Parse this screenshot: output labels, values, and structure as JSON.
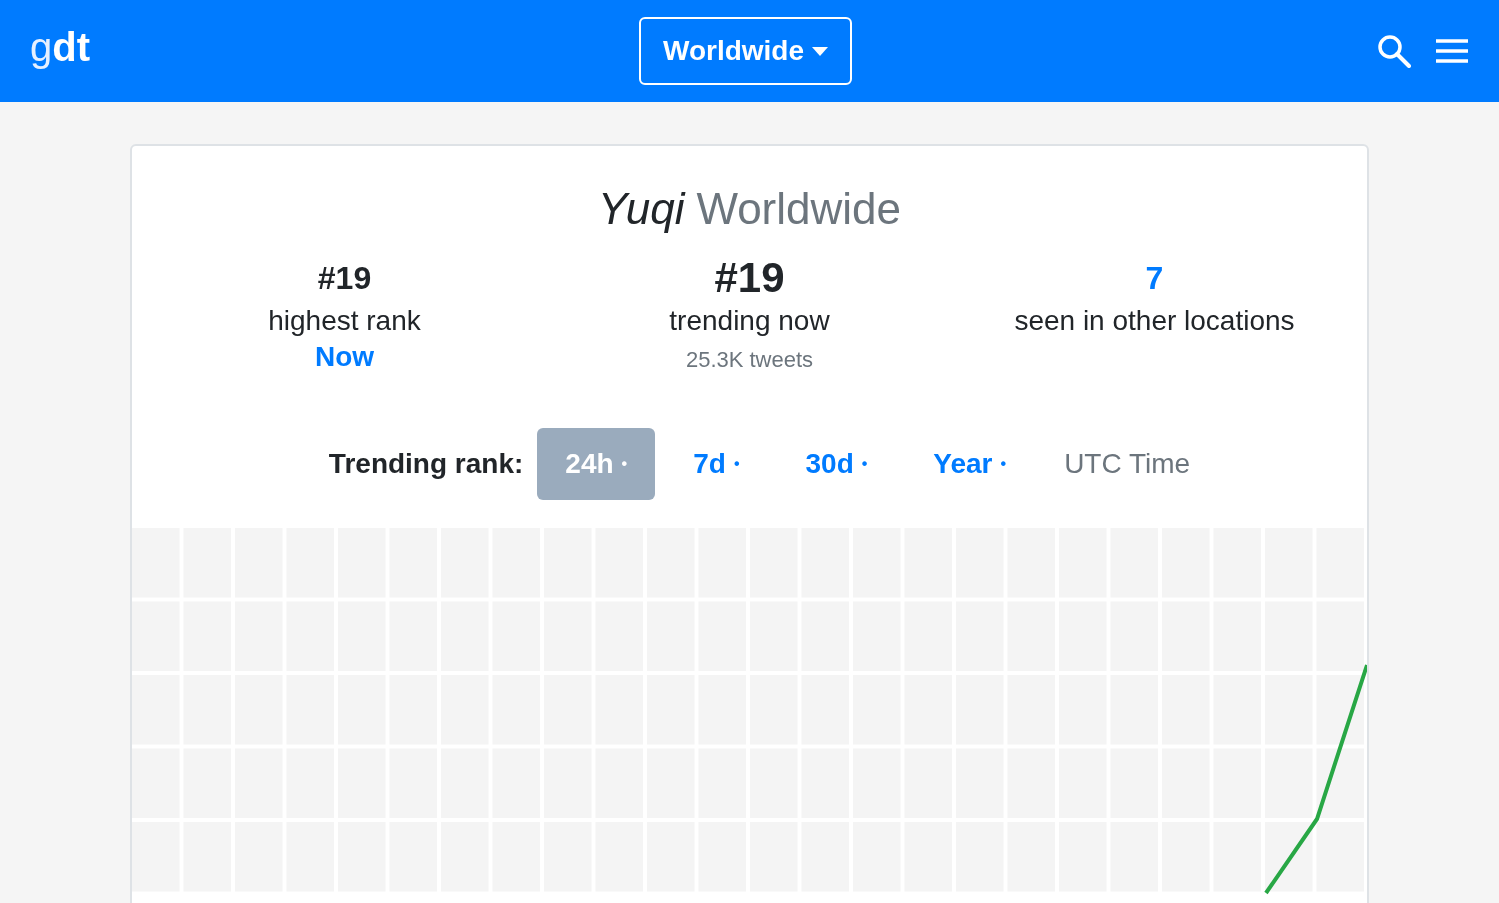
{
  "header": {
    "logo": "g**dt**",
    "location_dropdown": "Worldwide"
  },
  "card": {
    "topic": "Yuqi",
    "location": "Worldwide",
    "stats": [
      {
        "kind": "plain",
        "value": "#19",
        "label": "highest rank",
        "note": "Now"
      },
      {
        "kind": "big",
        "value": "#19",
        "label": "trending now",
        "note": "25.3K tweets"
      },
      {
        "kind": "link",
        "value": "7",
        "label": "seen in other locations"
      }
    ],
    "range_label": "Trending rank:",
    "ranges": [
      {
        "label": "24h",
        "dot": "•",
        "selected": true
      },
      {
        "label": "7d",
        "dot": "•",
        "selected": false
      },
      {
        "label": "30d",
        "dot": "•",
        "selected": false
      },
      {
        "label": "Year",
        "dot": "•",
        "selected": false
      }
    ],
    "timezone": "UTC Time"
  }
}
